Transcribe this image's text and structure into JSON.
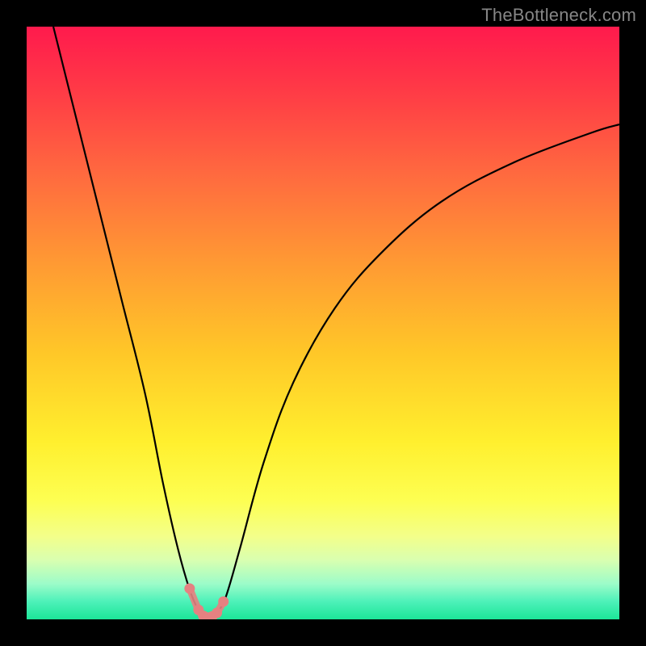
{
  "watermark": "TheBottleneck.com",
  "chart_data": {
    "type": "line",
    "title": "",
    "xlabel": "",
    "ylabel": "",
    "xlim": [
      0,
      100
    ],
    "ylim": [
      0,
      100
    ],
    "series": [
      {
        "name": "bottleneck-curve",
        "x": [
          4.5,
          8,
          12,
          16,
          20,
          23,
          25.5,
          27.5,
          29,
          30,
          31,
          32,
          33.5,
          36,
          40,
          45,
          52,
          60,
          70,
          82,
          95,
          100
        ],
        "values": [
          100,
          86,
          70,
          54,
          38,
          23,
          12,
          5,
          1.5,
          0.3,
          0.3,
          1.2,
          3.5,
          12,
          26.5,
          40,
          52.5,
          62,
          70.5,
          77,
          82,
          83.5
        ]
      },
      {
        "name": "marker-dots",
        "x": [
          27.5,
          29.0,
          29.8,
          30.5,
          31.3,
          32.1,
          33.2
        ],
        "values": [
          5.2,
          1.6,
          0.6,
          0.3,
          0.5,
          1.1,
          3.0
        ]
      }
    ],
    "colors": {
      "curve_stroke": "#000000",
      "marker_fill": "#e58181",
      "boundary_stroke": "#9cfcc9"
    }
  }
}
